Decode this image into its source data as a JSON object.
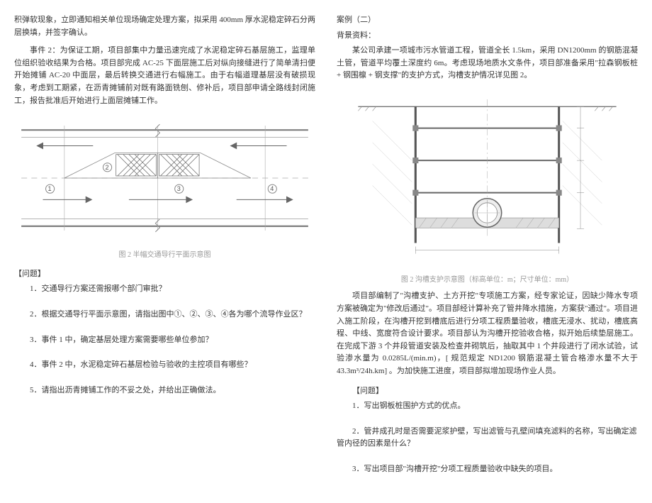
{
  "left": {
    "paragraph1": "积弹软现象，立即通知相关单位现场确定处理方案，拟采用 400mm 厚水泥稳定碎石分两层换填，并签字确认。",
    "paragraph2": "事件 2：为保证工期，项目部集中力量迅速完成了水泥稳定碎石基层施工，监理单位组织验收结果为合格。项目部完成 AC-25 下面层施工后对纵向接缝进行了简单清扫便开始摊铺 AC-20 中面层，最后转换交通进行右幅施工。由于右幅道理基层没有破损现象，考虑到工期紧，在沥青摊铺前对既有路面铣刨、修补后，项目部申请全路线封闭施工，报告批准后开始进行上面层摊铺工作。",
    "diagram1_caption": "图 2 半幅交通导行平面示意图",
    "questions_label": "【问题】",
    "q1": "1．交通导行方案还需报哪个部门审批？",
    "q2": "2．根据交通导行平面示意图，请指出图中①、②、③、④各为哪个流导作业区？",
    "q3": "3．事件 1 中，确定基层处理方案需要哪些单位参加？",
    "q4": "4．事件 2 中，水泥稳定碎石基层检验与验收的主控项目有哪些？",
    "q5": "5．请指出沥青摊铺工作的不妥之处，并给出正确做法。"
  },
  "right": {
    "case_title": "案例（二）",
    "bg_title": "背景资料：",
    "paragraph1": "某公司承建一项城市污水管道工程，管道全长 1.5km，采用 DN1200mm 的钢筋混凝土管，管道平均覆土深度约 6m。考虑现场地质水文条件，项目部准备采用\"拉森钢板桩 + 钢围檩 + 钢支撑\"的支护方式，沟槽支护情况详见图 2。",
    "diagram2_caption": "图 2 沟槽支护示意图（标高单位：m；尺寸单位：mm）",
    "paragraph2": "项目部编制了\"沟槽支护、土方开挖\"专项施工方案，经专家论证，因缺少降水专项方案被确定为\"修改后通过\"。项目部经计算补充了管井降水措施，方案获\"通过\"。项目进入施工阶段，在沟槽开挖到槽底后进行分项工程质量验收，槽底无浸水、扰动，槽底高程、中线、宽度符合设计要求。项目部认为沟槽开挖验收合格，拟开始后续垫层施工。在完成下游 3 个井段管道安装及检查井砌筑后，抽取其中 1 个井段进行了闭水试验，试验渗水量为 0.0285L/(min.m)，[ 规范规定 ND1200 钢筋混凝土管合格渗水量不大于 43.3m³/24h.km] 。为加快施工进度，项目部拟增加现场作业人员。",
    "questions_label": "【问题】",
    "q1": "1．写出钢板桩围护方式的优点。",
    "q2": "2．管井成孔时是否需要泥浆护壁，写出滤管与孔壁间填充滤料的名称，写出确定滤管内径的因素是什么？",
    "q3": "3．写出项目部\"沟槽开挖\"分项工程质量验收中缺失的项目。"
  }
}
